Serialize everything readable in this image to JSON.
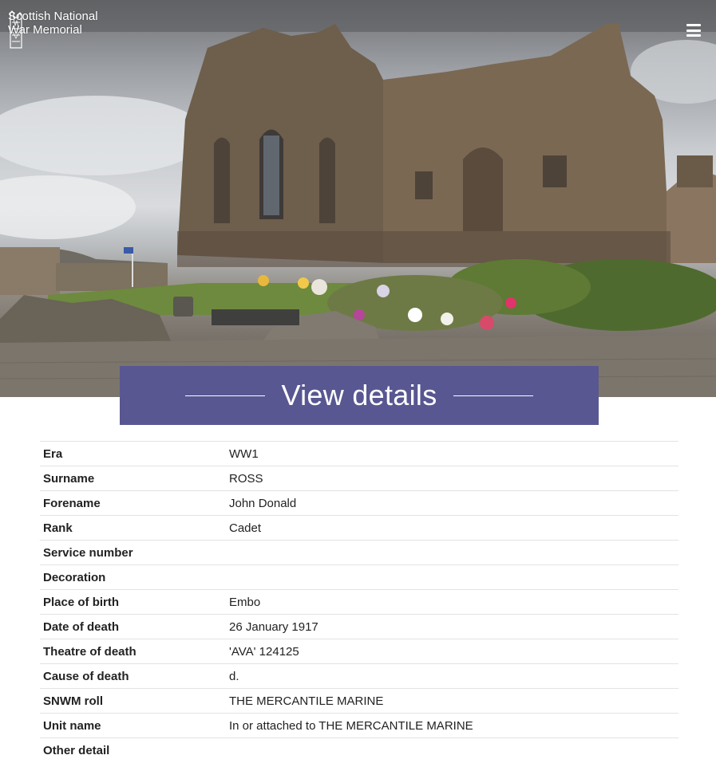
{
  "header": {
    "logo_line1": "Scottish National",
    "logo_line2": "War Memorial",
    "menu_icon": "hamburger-menu-icon"
  },
  "banner": {
    "title": "View details"
  },
  "details": {
    "rows": [
      {
        "label": "Era",
        "value": "WW1"
      },
      {
        "label": "Surname",
        "value": "ROSS"
      },
      {
        "label": "Forename",
        "value": "John Donald"
      },
      {
        "label": "Rank",
        "value": "Cadet"
      },
      {
        "label": "Service number",
        "value": ""
      },
      {
        "label": "Decoration",
        "value": ""
      },
      {
        "label": "Place of birth",
        "value": "Embo"
      },
      {
        "label": "Date of death",
        "value": "26 January 1917"
      },
      {
        "label": "Theatre of death",
        "value": "'AVA' 124125"
      },
      {
        "label": "Cause of death",
        "value": "d."
      },
      {
        "label": "SNWM roll",
        "value": "THE MERCANTILE MARINE"
      },
      {
        "label": "Unit name",
        "value": "In or attached to THE MERCANTILE MARINE"
      },
      {
        "label": "Other detail",
        "value": ""
      }
    ]
  },
  "colors": {
    "banner": "#585791",
    "text": "#222222",
    "divider": "#e3e3e3"
  }
}
